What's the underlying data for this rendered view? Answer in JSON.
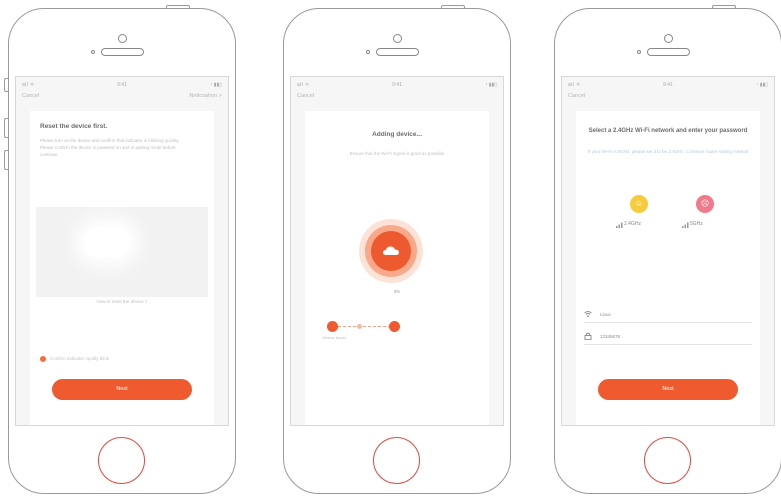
{
  "colors": {
    "accent": "#ef5a2f",
    "home_button": "#e0483e",
    "outline": "#9a9a9a"
  },
  "phones": [
    {
      "statusbar": {
        "signal": "atl ᯤ",
        "time": "9:41",
        "battery": "◔ ▮▮▯"
      },
      "navbar": {
        "cancel": "Cancel",
        "right": "Netlcoahon >"
      },
      "title": "Reset the device first.",
      "instructions": "Please turn on the device and confirm that indicator is blinking quickly. Please confirm the device is powered on and in pairing mode before continue.",
      "help_link": "How to reset the device >",
      "confirm_text": "Confirm indicator rapidly blink",
      "next_button": "Next"
    },
    {
      "statusbar": {
        "signal": "atl ᯤ",
        "time": "9:41",
        "battery": "◔ ▮▮▯"
      },
      "navbar": {
        "cancel": "Cancel"
      },
      "title": "Adding device...",
      "subtitle": "Ensure that the Wi-Fi signal is good as possible",
      "percent": "0%",
      "steps": [
        {
          "label": "Device found"
        }
      ]
    },
    {
      "statusbar": {
        "signal": "atl ᯤ",
        "time": "9:41",
        "battery": "◔ ▮▮▯"
      },
      "navbar": {
        "cancel": "Cancel"
      },
      "title": "Select a 2.4GHz Wi-Fi network and enter your password",
      "subtitle": "If your Wi-Fi is 5GHz, please set it to be 2.4GHz. Common router setting method",
      "bands": [
        {
          "label": "2.4GHz",
          "icon": "happy-face-icon",
          "color": "#f7cb3c"
        },
        {
          "label": "5GHz",
          "icon": "sad-face-icon",
          "color": "#f07a8a"
        }
      ],
      "wifi_name": "Linux",
      "password": "12345678",
      "next_button": "Next"
    }
  ]
}
